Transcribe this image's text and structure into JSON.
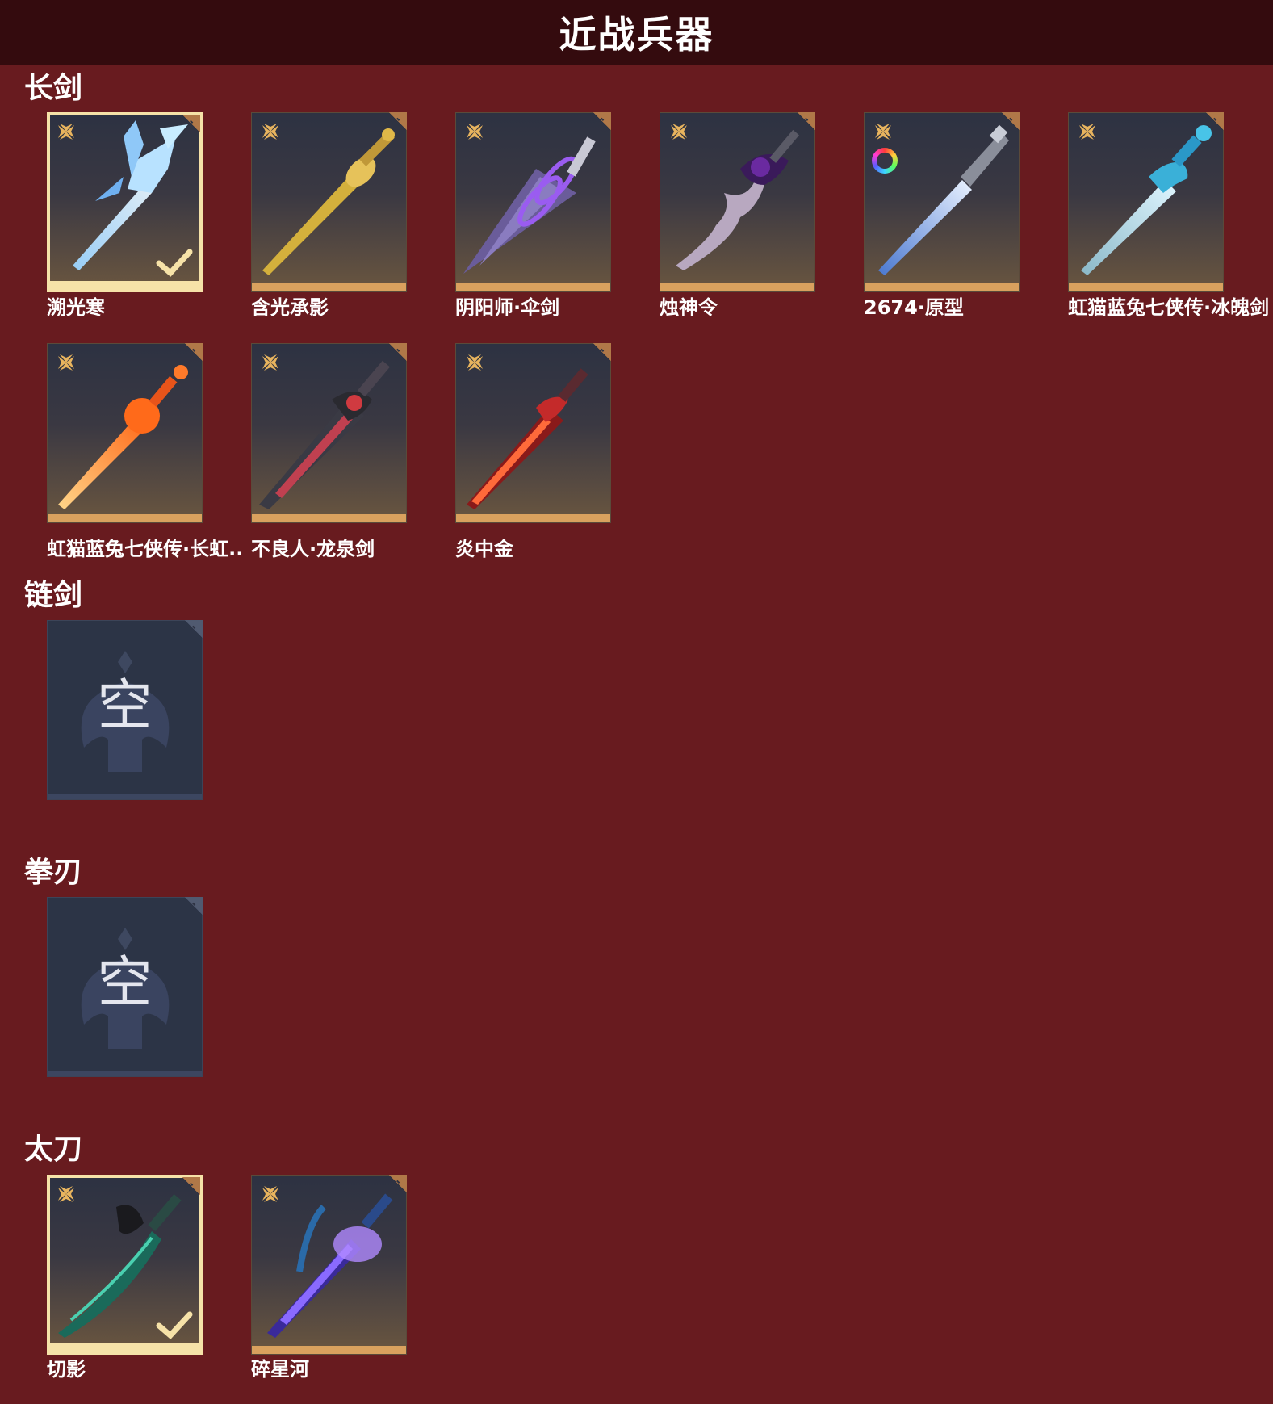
{
  "page": {
    "title": "近战兵器"
  },
  "sections": [
    {
      "label": "长剑",
      "items": [
        {
          "name": "溯光寒",
          "selected": true,
          "weapon_icon": "ice-sword-icon"
        },
        {
          "name": "含光承影",
          "selected": false,
          "weapon_icon": "golden-sword-icon"
        },
        {
          "name": "阴阳师·伞剑",
          "selected": false,
          "weapon_icon": "umbrella-sword-icon"
        },
        {
          "name": "烛神令",
          "selected": false,
          "weapon_icon": "dragon-sword-icon"
        },
        {
          "name": "2674·原型",
          "selected": false,
          "weapon_icon": "light-saber-icon",
          "has_color_dye": true
        },
        {
          "name": "虹猫蓝兔七侠传·冰魄剑",
          "selected": false,
          "weapon_icon": "cyan-sword-icon"
        },
        {
          "name": "虹猫蓝兔七侠传·长虹剑",
          "display_name": "虹猫蓝兔七侠传·长虹..",
          "selected": false,
          "weapon_icon": "flame-sword-icon"
        },
        {
          "name": "不良人·龙泉剑",
          "selected": false,
          "weapon_icon": "dark-sword-icon"
        },
        {
          "name": "炎中金",
          "selected": false,
          "weapon_icon": "crimson-sword-icon"
        }
      ]
    },
    {
      "label": "链剑",
      "items": [],
      "empty_text": "空"
    },
    {
      "label": "拳刃",
      "items": [],
      "empty_text": "空"
    },
    {
      "label": "太刀",
      "items": [
        {
          "name": "切影",
          "selected": true,
          "weapon_icon": "jade-katana-icon"
        },
        {
          "name": "碎星河",
          "selected": false,
          "weapon_icon": "violet-katana-icon"
        }
      ]
    }
  ],
  "colors": {
    "background": "#681b1f",
    "title_bar": "#340b0e",
    "selected_border": "#f6e2a8",
    "tile_bottom": "#d9a15e",
    "quality_icon": "#e8b45e"
  }
}
